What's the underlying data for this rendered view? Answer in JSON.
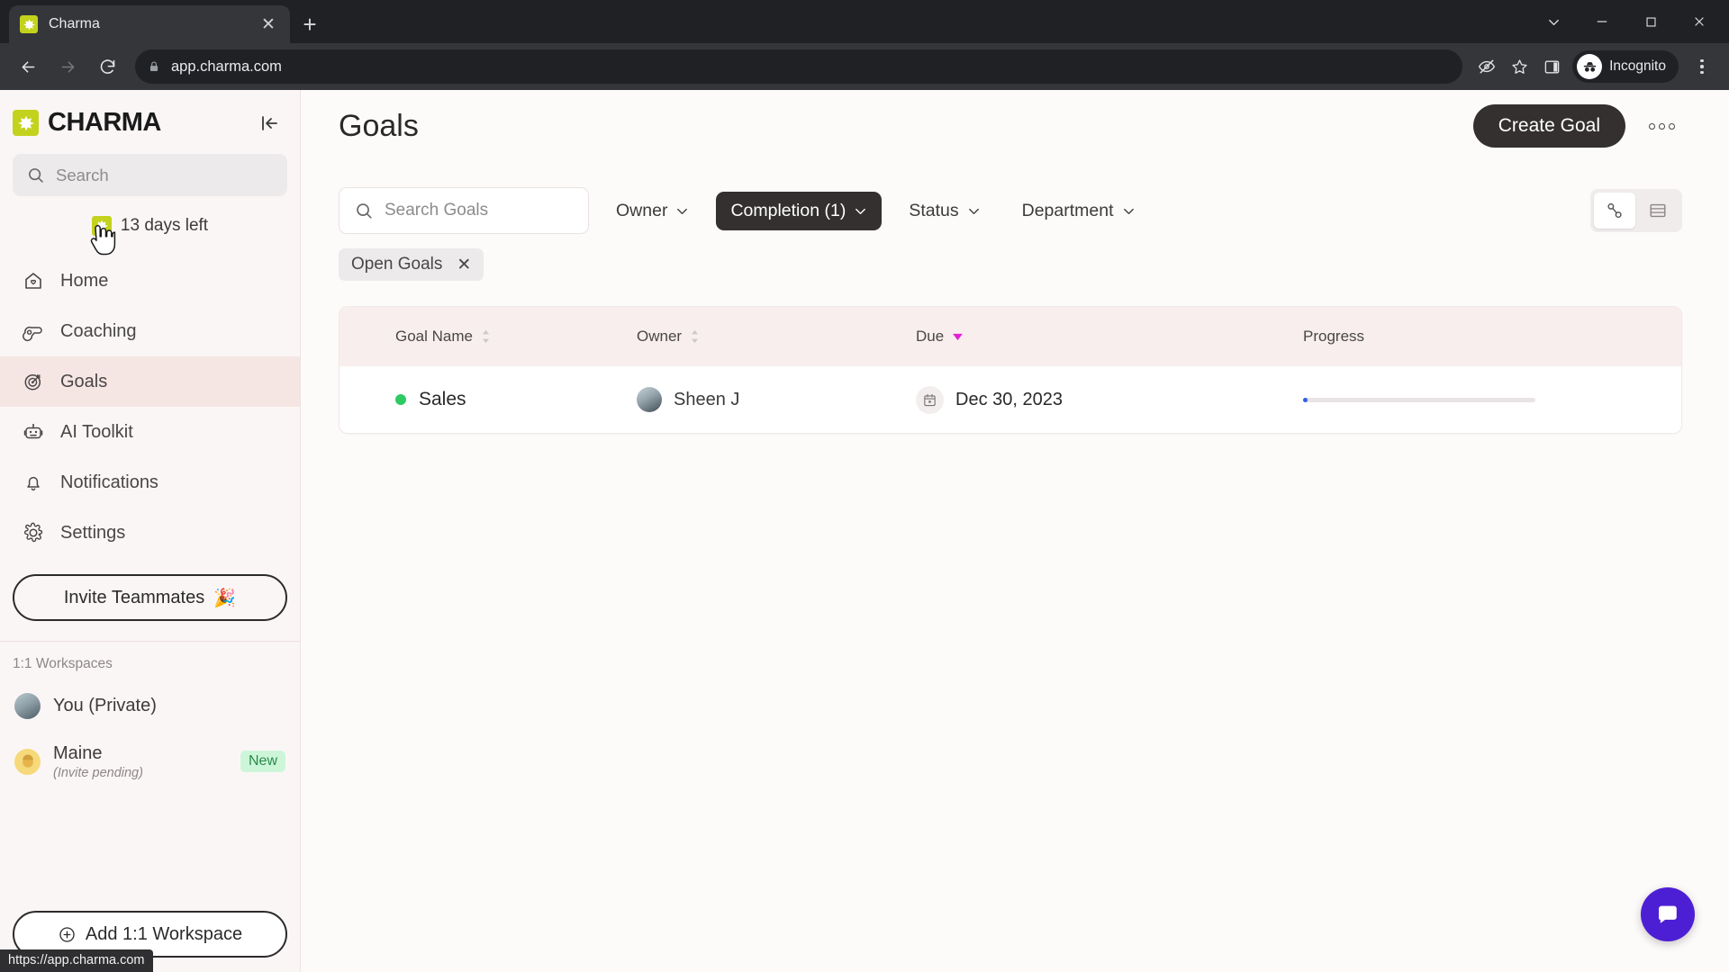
{
  "browser": {
    "tab": {
      "title": "Charma",
      "favicon_icon": "charma-star-icon",
      "close_icon": "close-icon"
    },
    "new_tab_icon": "plus-icon",
    "window": {
      "minimize_icon": "minimize-icon",
      "maximize_icon": "maximize-icon",
      "close_icon": "window-close-icon",
      "tab_search_icon": "chevron-down-icon"
    },
    "nav": {
      "back_icon": "back-arrow-icon",
      "forward_icon": "forward-arrow-icon",
      "reload_icon": "reload-icon"
    },
    "omnibox": {
      "lock_icon": "lock-icon",
      "url": "app.charma.com"
    },
    "toolbar_icons": [
      "eye-off-icon",
      "star-icon",
      "side-panel-icon"
    ],
    "profile": {
      "label": "Incognito",
      "icon": "incognito-icon"
    },
    "menu_icon": "kebab-menu-icon"
  },
  "status_bar": {
    "url": "https://app.charma.com"
  },
  "sidebar": {
    "brand": {
      "name": "CHARMA",
      "mark_icon": "charma-star-icon",
      "mark_color": "#c3d21c"
    },
    "collapse_icon": "collapse-sidebar-icon",
    "search": {
      "placeholder": "Search",
      "icon": "search-icon"
    },
    "trial": {
      "label": "13 days left",
      "icon": "charma-star-icon"
    },
    "items": [
      {
        "label": "Home",
        "icon": "home-icon",
        "active": false
      },
      {
        "label": "Coaching",
        "icon": "whistle-icon",
        "active": false
      },
      {
        "label": "Goals",
        "icon": "target-icon",
        "active": true
      },
      {
        "label": "AI Toolkit",
        "icon": "robot-icon",
        "active": false
      },
      {
        "label": "Notifications",
        "icon": "bell-icon",
        "active": false
      },
      {
        "label": "Settings",
        "icon": "gear-icon",
        "active": false
      }
    ],
    "invite_button": {
      "label": "Invite Teammates",
      "emoji": "🎉"
    },
    "workspaces_label": "1:1 Workspaces",
    "workspaces": [
      {
        "name": "You (Private)",
        "sub": "",
        "badge": "",
        "avatar": "user-avatar"
      },
      {
        "name": "Maine",
        "sub": "(Invite pending)",
        "badge": "New",
        "avatar": "maine-avatar"
      }
    ],
    "add_workspace_button": {
      "label": "Add 1:1 Workspace",
      "icon": "plus-circle-icon"
    }
  },
  "header": {
    "title": "Goals",
    "create_goal_label": "Create Goal",
    "more_icon": "more-options-icon"
  },
  "filters": {
    "search": {
      "placeholder": "Search Goals",
      "icon": "search-icon",
      "value": ""
    },
    "buttons": [
      {
        "label": "Owner",
        "active": false,
        "icon": "chevron-down-icon"
      },
      {
        "label": "Completion (1)",
        "active": true,
        "icon": "chevron-down-icon"
      },
      {
        "label": "Status",
        "active": false,
        "icon": "chevron-down-icon"
      },
      {
        "label": "Department",
        "active": false,
        "icon": "chevron-down-icon"
      }
    ],
    "chips": [
      {
        "label": "Open Goals",
        "remove_icon": "close-icon"
      }
    ],
    "view_toggle": [
      {
        "icon": "tree-view-icon",
        "selected": true
      },
      {
        "icon": "list-view-icon",
        "selected": false
      }
    ]
  },
  "table": {
    "columns": [
      {
        "label": "Goal Name",
        "sort": "none"
      },
      {
        "label": "Owner",
        "sort": "none"
      },
      {
        "label": "Due",
        "sort": "desc"
      },
      {
        "label": "Progress",
        "sort": null
      }
    ],
    "sort_active_color": "#e321d6",
    "rows": [
      {
        "status_color": "#2ecb62",
        "goal_name": "Sales",
        "owner": "Sheen J",
        "due": "Dec 30, 2023",
        "progress_percent": 2
      }
    ]
  },
  "chat": {
    "icon": "chat-bubble-icon",
    "color": "#4d1fd4"
  }
}
